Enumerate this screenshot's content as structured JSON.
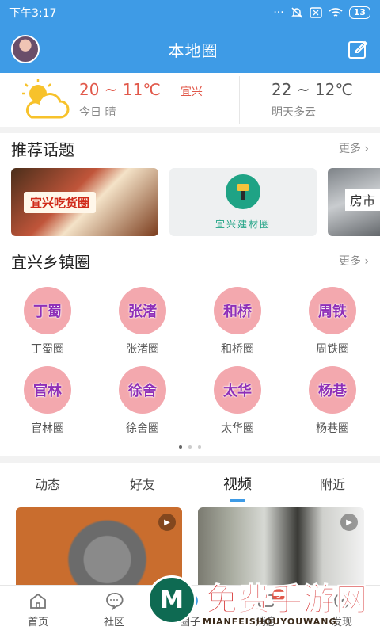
{
  "status_bar": {
    "time": "下午3:17",
    "battery": "13"
  },
  "header": {
    "title": "本地圈"
  },
  "weather": {
    "today_temp": "20 ~ 11℃",
    "city": "宜兴",
    "today_desc": "今日 晴",
    "tomorrow_temp": "22 ~ 12℃",
    "tomorrow_desc": "明天多云"
  },
  "topics": {
    "title": "推荐话题",
    "more": "更多",
    "cards": [
      {
        "label": "宜兴吃货圈"
      },
      {
        "label": "宜兴建材圈"
      },
      {
        "label": "房市"
      }
    ]
  },
  "towns": {
    "title": "宜兴乡镇圈",
    "more": "更多",
    "items": [
      {
        "badge": "丁蜀",
        "name": "丁蜀圈"
      },
      {
        "badge": "张渚",
        "name": "张渚圈"
      },
      {
        "badge": "和桥",
        "name": "和桥圈"
      },
      {
        "badge": "周铁",
        "name": "周铁圈"
      },
      {
        "badge": "官林",
        "name": "官林圈"
      },
      {
        "badge": "徐舍",
        "name": "徐舍圈"
      },
      {
        "badge": "太华",
        "name": "太华圈"
      },
      {
        "badge": "杨巷",
        "name": "杨巷圈"
      }
    ]
  },
  "feed_tabs": [
    "动态",
    "好友",
    "视频",
    "附近"
  ],
  "bottom_nav": {
    "items": [
      "首页",
      "社区",
      "圈子",
      "消息",
      "发现"
    ],
    "badge": "3"
  },
  "watermark": {
    "logo": "M",
    "text": "免费手游网",
    "sub": "MIANFEISHOUYOUWANG"
  },
  "colors": {
    "brand": "#3e9be6",
    "accent": "#e1584a",
    "town_badge": "#f3a8ae"
  }
}
